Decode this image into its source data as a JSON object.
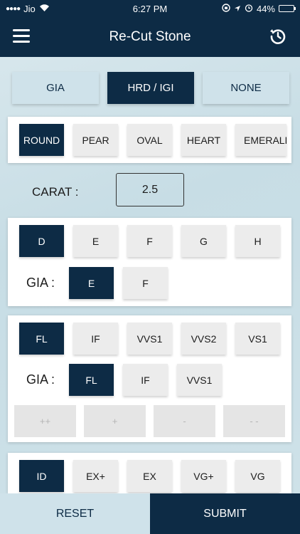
{
  "status_bar": {
    "carrier": "Jio",
    "time": "6:27 PM",
    "battery": "44%",
    "battery_level": 0.44
  },
  "header": {
    "title": "Re-Cut Stone",
    "menu_icon": "menu-icon",
    "history_icon": "history-icon"
  },
  "lab_options": [
    {
      "label": "GIA",
      "selected": false
    },
    {
      "label": "HRD / IGI",
      "selected": true
    },
    {
      "label": "NONE",
      "selected": false
    }
  ],
  "shapes": [
    {
      "label": "ROUND",
      "selected": true
    },
    {
      "label": "PEAR",
      "selected": false
    },
    {
      "label": "OVAL",
      "selected": false
    },
    {
      "label": "HEART",
      "selected": false
    },
    {
      "label": "EMERALD",
      "selected": false
    }
  ],
  "carat": {
    "label": "CARAT :",
    "value": "2.5"
  },
  "color": {
    "options": [
      "D",
      "E",
      "F",
      "G",
      "H"
    ],
    "selected": "D",
    "gia_label": "GIA :",
    "gia_options": [
      "E",
      "F"
    ],
    "gia_selected": "E"
  },
  "clarity": {
    "options": [
      "FL",
      "IF",
      "VVS1",
      "VVS2",
      "VS1"
    ],
    "selected": "FL",
    "gia_label": "GIA :",
    "gia_options": [
      "FL",
      "IF",
      "VVS1"
    ],
    "gia_selected": "FL",
    "modifiers": [
      "++",
      "+",
      "-",
      "- -"
    ]
  },
  "cut": {
    "options": [
      "ID",
      "EX+",
      "EX",
      "VG+",
      "VG"
    ],
    "selected": "ID"
  },
  "footer": {
    "reset_label": "RESET",
    "submit_label": "SUBMIT"
  },
  "colors": {
    "primary": "#0d2b45",
    "accent_light": "#cfe2ea",
    "chip_bg": "#ececec"
  }
}
